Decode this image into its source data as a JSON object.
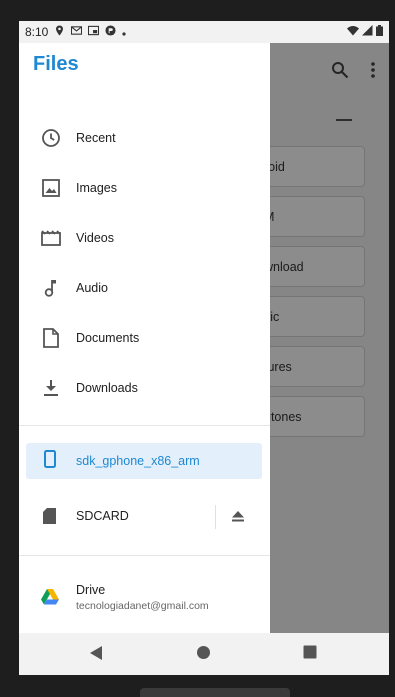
{
  "status_bar": {
    "time": "8:10"
  },
  "drawer": {
    "title": "Files",
    "items": [
      {
        "label": "Recent",
        "icon": "clock-icon"
      },
      {
        "label": "Images",
        "icon": "image-icon"
      },
      {
        "label": "Videos",
        "icon": "film-icon"
      },
      {
        "label": "Audio",
        "icon": "music-note-icon"
      },
      {
        "label": "Documents",
        "icon": "document-icon"
      },
      {
        "label": "Downloads",
        "icon": "download-icon"
      }
    ],
    "devices": {
      "internal": {
        "label": "sdk_gphone_x86_arm",
        "icon": "phone-icon",
        "selected": true
      },
      "sdcard": {
        "label": "SDCARD",
        "icon": "sdcard-icon"
      }
    },
    "accounts": {
      "drive": {
        "label": "Drive",
        "email": "tecnologiadanet@gmail.com",
        "icon": "google-drive-icon"
      }
    }
  },
  "background_list": {
    "items": [
      "roid",
      "M",
      "wnload",
      "sic",
      "tures",
      "gtones"
    ]
  },
  "colors": {
    "accent": "#1e88d2",
    "selected_bg": "#e3f0fb"
  }
}
